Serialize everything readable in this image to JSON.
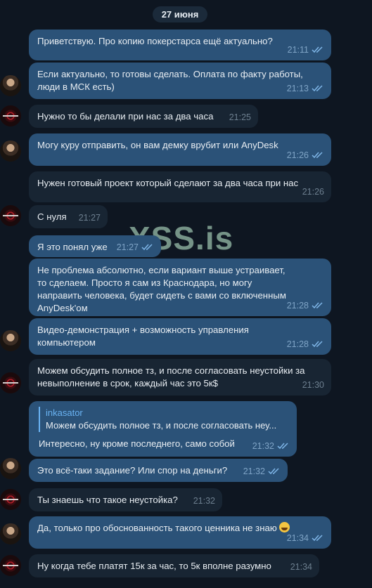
{
  "date_label": "27 июня",
  "watermark": "XSS.is",
  "messages": [
    {
      "text": "Приветствую. Про копию покерстарса ещё актуально?",
      "time": "21:11"
    },
    {
      "text": "Если актуально, то готовы сделать. Оплата по факту работы, люди в МСК есть)",
      "time": "21:13"
    },
    {
      "text": "Нужно то бы делали при нас за два часа",
      "time": "21:25"
    },
    {
      "text": "Могу куру отправить, он вам демку врубит или AnyDesk",
      "time": "21:26"
    },
    {
      "text": "Нужен готовый проект который сделают за два часа при нас",
      "time": "21:26"
    },
    {
      "text": "С нуля",
      "time": "21:27"
    },
    {
      "text": "Я это понял уже",
      "time": "21:27"
    },
    {
      "text": "Не проблема абсолютно, если вариант выше устраивает, то сделаем. Просто я сам из Краснодара, но могу направить человека, будет сидеть с вами со включенным AnyDesk'ом",
      "time": "21:28"
    },
    {
      "text": "Видео-демонстрация + возможность управления компьютером",
      "time": "21:28"
    },
    {
      "text": "Можем обсудить полное тз, и после согласовать неустойки за невыполнение в срок, каждый час это 5к$",
      "time": "21:30"
    },
    {
      "reply_name": "inkasator",
      "reply_text": "Можем обсудить полное тз, и после согласовать неу...",
      "text": "Интересно, ну кроме последнего, само собой",
      "time": "21:32"
    },
    {
      "text": "Это всё-таки задание? Или спор на деньги?",
      "time": "21:32"
    },
    {
      "text": "Ты знаешь что такое неустойка?",
      "time": "21:32"
    },
    {
      "text": "Да, только про обоснованность такого ценника не знаю",
      "time": "21:34"
    },
    {
      "text": "Ну когда тебе платят 15к за час, то 5к вполне разумно",
      "time": "21:34"
    }
  ],
  "colors": {
    "background": "#0e1621",
    "outgoing": "#2b5278",
    "incoming": "#182533",
    "accent": "#6ab3f3"
  }
}
